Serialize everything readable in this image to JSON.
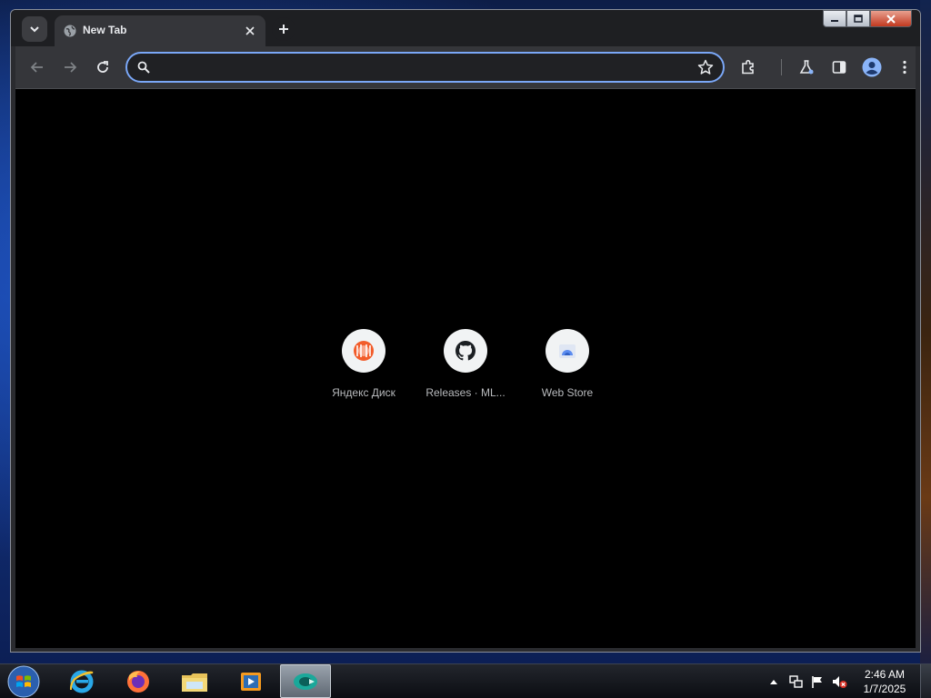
{
  "browser": {
    "tab": {
      "title": "New Tab"
    },
    "omnibox": {
      "value": "",
      "placeholder": ""
    }
  },
  "new_tab_page": {
    "shortcuts": [
      {
        "label": "Яндекс Диск",
        "icon": "yandex-disk-icon"
      },
      {
        "label": "Releases · ML...",
        "icon": "github-icon"
      },
      {
        "label": "Web Store",
        "icon": "web-store-icon"
      }
    ]
  },
  "taskbar": {
    "apps": [
      "internet-explorer-icon",
      "firefox-icon",
      "file-explorer-icon",
      "media-player-icon",
      "chrome-app-icon"
    ],
    "clock": {
      "time": "2:46 AM",
      "date": "1/7/2025"
    }
  },
  "colors": {
    "accent": "#7aa7f7",
    "content_bg": "#000000",
    "toolbar_bg": "#35363a"
  }
}
